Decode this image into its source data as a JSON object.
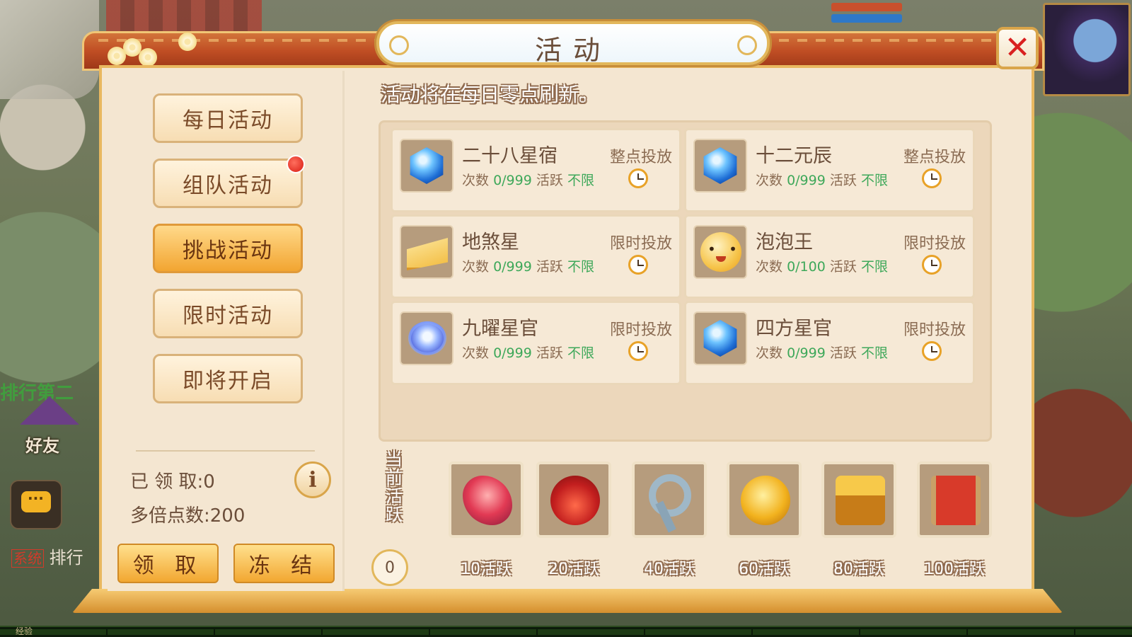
{
  "hud": {
    "friend_label": "好友",
    "xp_label": "经验",
    "system_tag": "系统",
    "system_text": "排行",
    "rank_text": "排行第二"
  },
  "panel": {
    "title": "活动",
    "notice": "活动将在每日零点刷新。",
    "close_symbol": "✕"
  },
  "tabs": [
    {
      "label": "每日活动",
      "active": false,
      "red_dot": false
    },
    {
      "label": "组队活动",
      "active": false,
      "red_dot": true
    },
    {
      "label": "挑战活动",
      "active": true,
      "red_dot": false
    },
    {
      "label": "限时活动",
      "active": false,
      "red_dot": false
    },
    {
      "label": "即将开启",
      "active": false,
      "red_dot": false
    }
  ],
  "stats": {
    "claimed": "已 领 取:0",
    "multiplier": "多倍点数:200",
    "info_symbol": "i"
  },
  "actions": {
    "claim": "领 取",
    "freeze": "冻 结"
  },
  "activities": [
    {
      "name": "二十八星宿",
      "count_label": "次数",
      "count": "0/999",
      "active_label": "活跃",
      "active_value": "不限",
      "mode": "整点投放",
      "icon": "blue-gem-icon"
    },
    {
      "name": "十二元辰",
      "count_label": "次数",
      "count": "0/999",
      "active_label": "活跃",
      "active_value": "不限",
      "mode": "整点投放",
      "icon": "blue-gem-icon"
    },
    {
      "name": "地煞星",
      "count_label": "次数",
      "count": "0/999",
      "active_label": "活跃",
      "active_value": "不限",
      "mode": "限时投放",
      "icon": "cheese-icon"
    },
    {
      "name": "泡泡王",
      "count_label": "次数",
      "count": "0/100",
      "active_label": "活跃",
      "active_value": "不限",
      "mode": "限时投放",
      "icon": "bubble-king-icon"
    },
    {
      "name": "九曜星官",
      "count_label": "次数",
      "count": "0/999",
      "active_label": "活跃",
      "active_value": "不限",
      "mode": "限时投放",
      "icon": "swirl-orb-icon"
    },
    {
      "name": "四方星官",
      "count_label": "次数",
      "count": "0/999",
      "active_label": "活跃",
      "active_value": "不限",
      "mode": "限时投放",
      "icon": "blue-gem-icon"
    }
  ],
  "progress": {
    "label": "当前活跃",
    "value": "0"
  },
  "rewards": [
    {
      "label": "10活跃",
      "icon": "seahorse-icon"
    },
    {
      "label": "20活跃",
      "icon": "treasure-pouch-icon"
    },
    {
      "label": "40活跃",
      "icon": "key-icon"
    },
    {
      "label": "60活跃",
      "icon": "gold-jar-icon"
    },
    {
      "label": "80活跃",
      "icon": "treasure-chest-icon"
    },
    {
      "label": "100活跃",
      "icon": "scroll-icon"
    }
  ],
  "colors": {
    "accent_gold": "#f2a531",
    "green_value": "#3ea85a",
    "close_red": "#d92020",
    "panel_bg": "#f4e6d1"
  }
}
